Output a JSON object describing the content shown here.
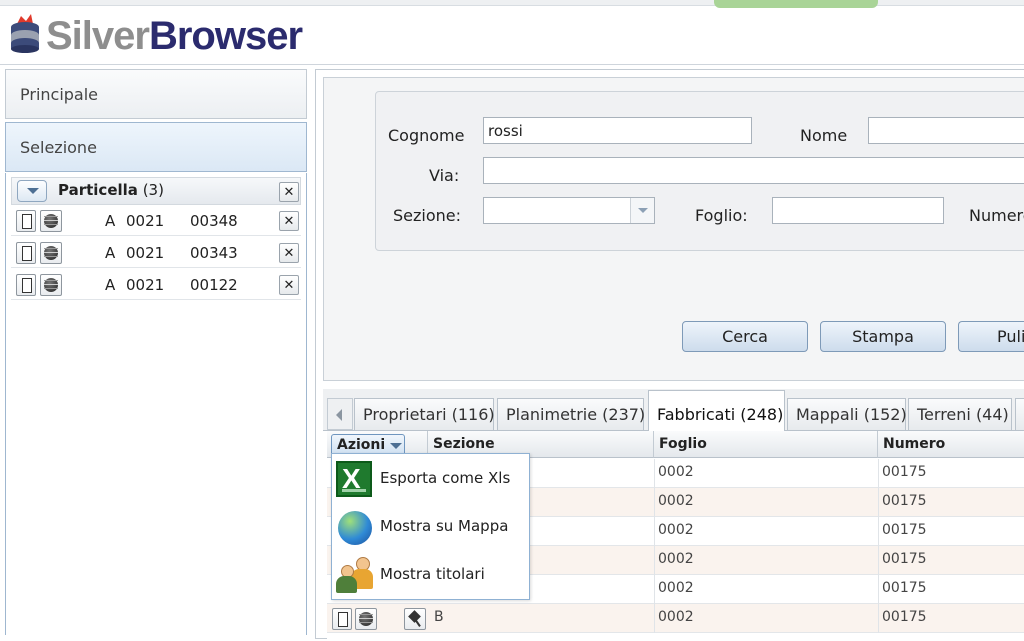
{
  "app": {
    "logo_part1": "Silver",
    "logo_part2": "Browser"
  },
  "sidebar": {
    "principale": "Principale",
    "selezione": "Selezione",
    "group_title": "Particella",
    "group_count": "(3)",
    "items": [
      {
        "sezione": "A",
        "foglio": "0021",
        "numero": "00348"
      },
      {
        "sezione": "A",
        "foglio": "0021",
        "numero": "00343"
      },
      {
        "sezione": "A",
        "foglio": "0021",
        "numero": "00122"
      }
    ]
  },
  "form": {
    "cognome_label": "Cognome",
    "cognome_value": "rossi",
    "nome_label": "Nome",
    "nome_value": "",
    "via_label": "Via:",
    "via_value": "",
    "sezione_label": "Sezione:",
    "sezione_value": "",
    "foglio_label": "Foglio:",
    "foglio_value": "",
    "numero_label": "Numero",
    "cerca": "Cerca",
    "stampa": "Stampa",
    "pulisci": "Puli"
  },
  "tabs": [
    {
      "label": "Proprietari (116)"
    },
    {
      "label": "Planimetrie (237)"
    },
    {
      "label": "Fabbricati (248)"
    },
    {
      "label": "Mappali (152)"
    },
    {
      "label": "Terreni (44)"
    }
  ],
  "grid": {
    "azioni": "Azioni",
    "columns": [
      "Sezione",
      "Foglio",
      "Numero"
    ],
    "rows": [
      {
        "sezione": "",
        "foglio": "0002",
        "numero": "00175"
      },
      {
        "sezione": "",
        "foglio": "0002",
        "numero": "00175"
      },
      {
        "sezione": "",
        "foglio": "0002",
        "numero": "00175"
      },
      {
        "sezione": "",
        "foglio": "0002",
        "numero": "00175"
      },
      {
        "sezione": "",
        "foglio": "0002",
        "numero": "00175"
      },
      {
        "sezione": "B",
        "foglio": "0002",
        "numero": "00175"
      }
    ]
  },
  "azioni_menu": [
    {
      "label": "Esporta come Xls",
      "icon": "excel-icon"
    },
    {
      "label": "Mostra su Mappa",
      "icon": "globe-map-icon"
    },
    {
      "label": "Mostra titolari",
      "icon": "owners-icon"
    }
  ]
}
